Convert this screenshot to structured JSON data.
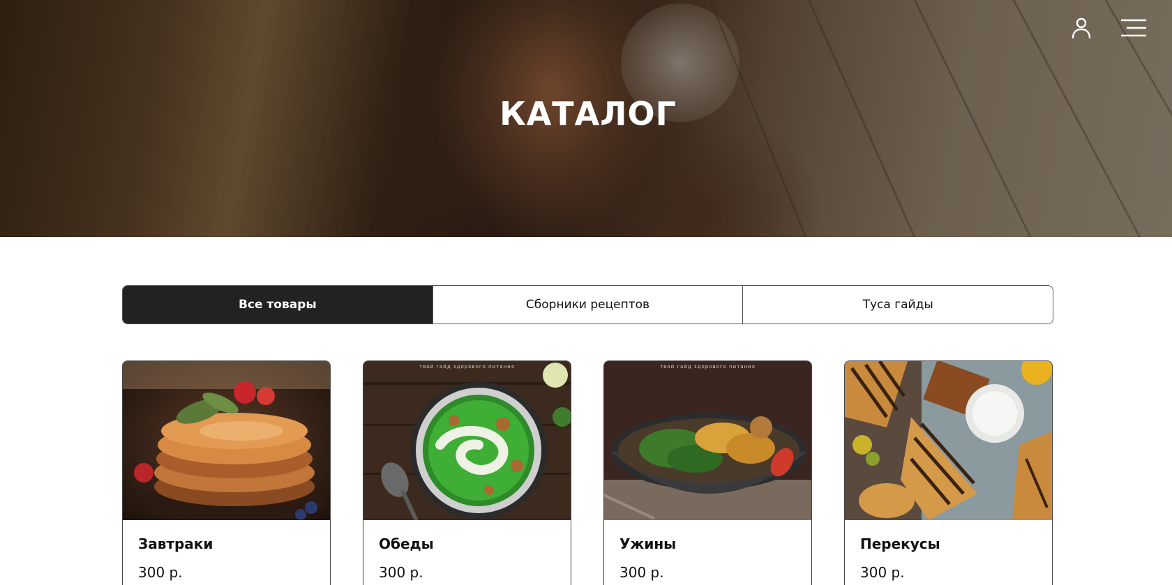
{
  "hero": {
    "title": "КАТАЛОГ",
    "user_icon": "user-icon",
    "menu_icon": "hamburger-menu-icon"
  },
  "tabs": [
    {
      "label": "Все товары",
      "active": true
    },
    {
      "label": "Сборники рецептов",
      "active": false
    },
    {
      "label": "Туса гайды",
      "active": false
    }
  ],
  "products": [
    {
      "name": "Завтраки",
      "price": "300 р.",
      "image": "pancakes-with-strawberries"
    },
    {
      "name": "Обеды",
      "price": "300 р.",
      "image": "green-cream-soup",
      "caption": "твой гайд здорового питания"
    },
    {
      "name": "Ужины",
      "price": "300 р.",
      "image": "salad-bowl",
      "caption": "твой гайд здорового питания"
    },
    {
      "name": "Перекусы",
      "price": "300 р.",
      "image": "grilled-sandwiches"
    }
  ]
}
